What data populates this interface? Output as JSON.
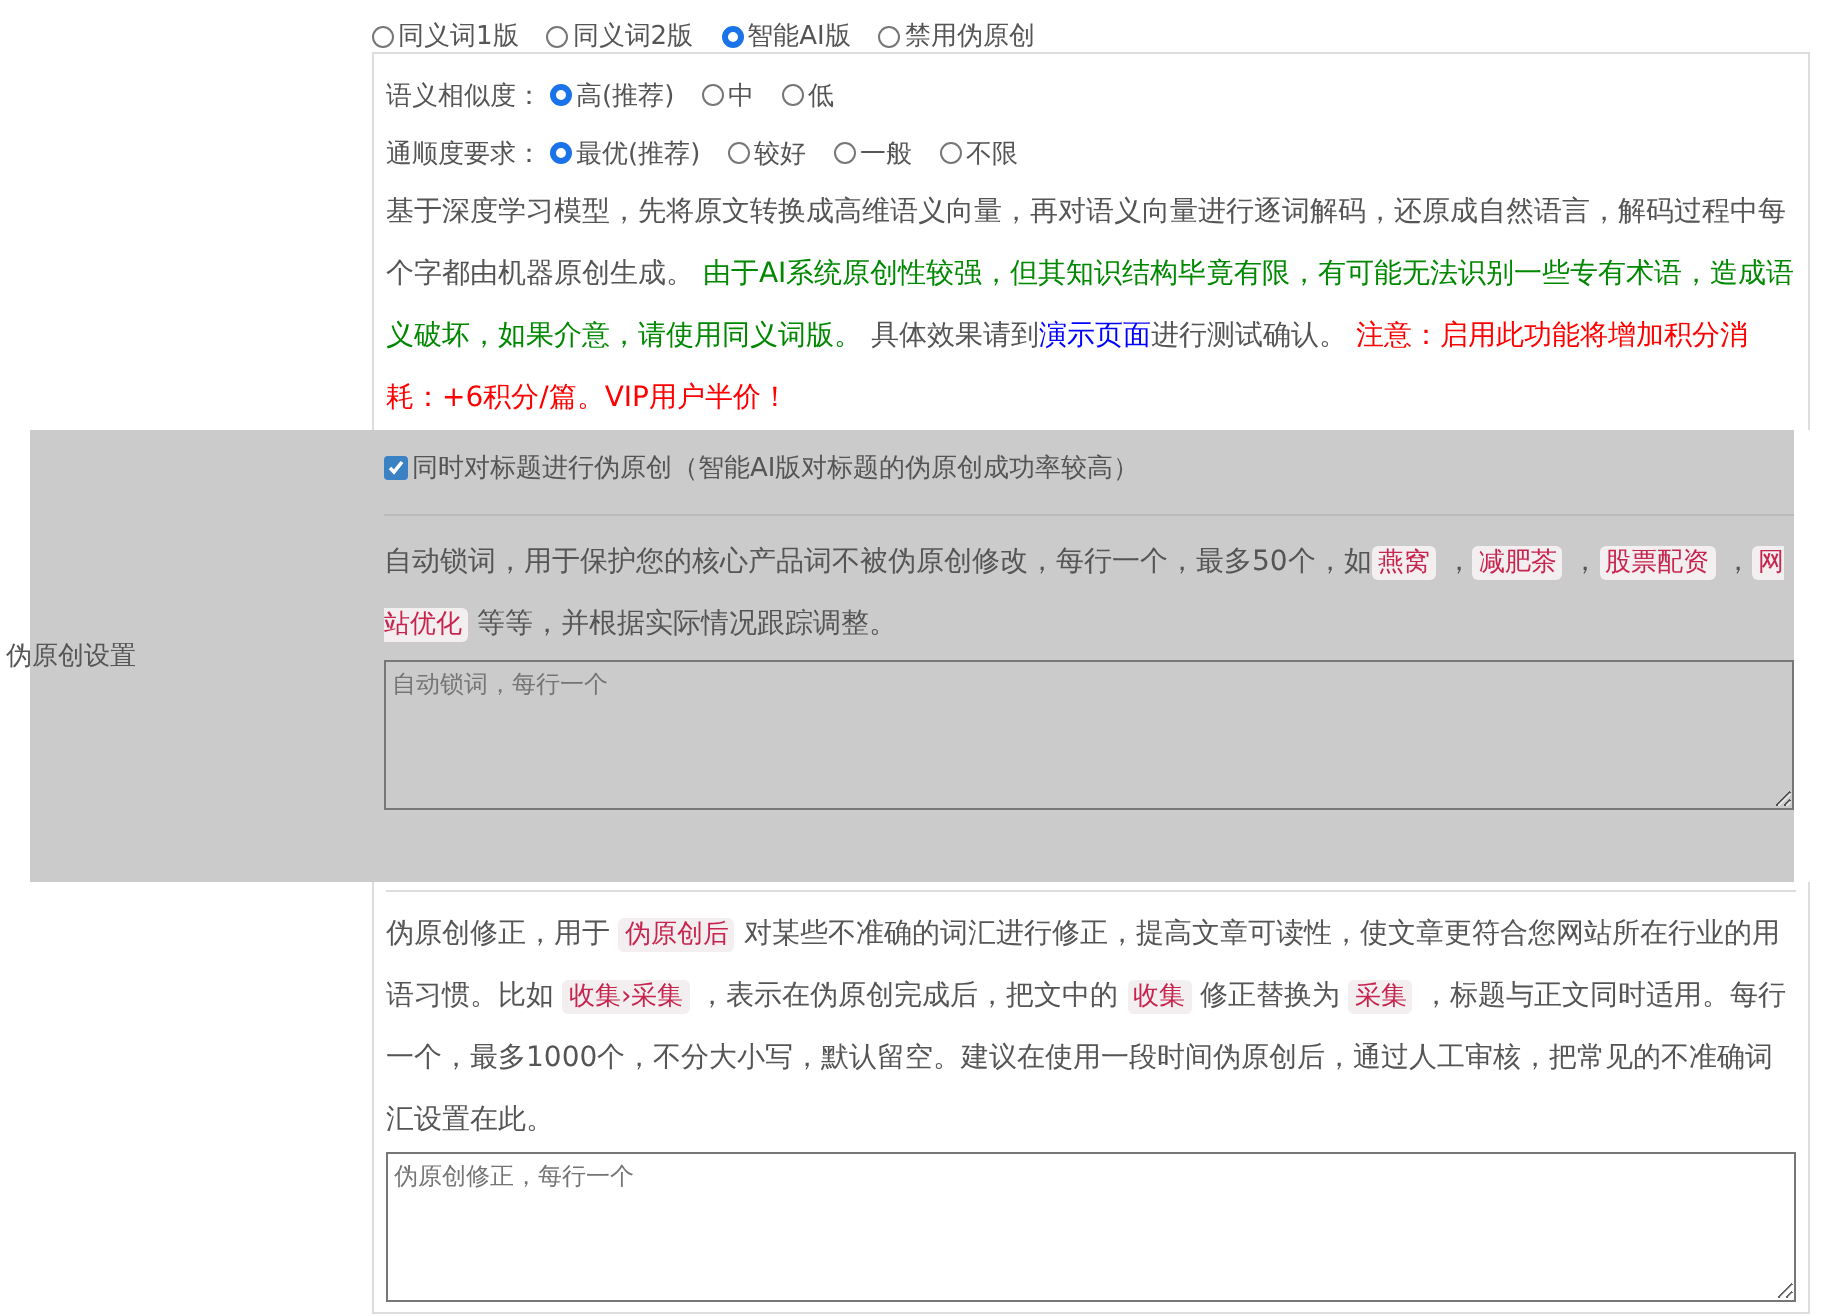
{
  "mode_options": [
    {
      "label": "同义词1版",
      "selected": false
    },
    {
      "label": "同义词2版",
      "selected": false
    },
    {
      "label": "智能AI版",
      "selected": true
    },
    {
      "label": "禁用伪原创",
      "selected": false
    }
  ],
  "settings": [
    {
      "label": "语义相似度：",
      "options": [
        {
          "label": "高(推荐)",
          "selected": true
        },
        {
          "label": "中",
          "selected": false
        },
        {
          "label": "低",
          "selected": false
        }
      ]
    },
    {
      "label": "通顺度要求：",
      "options": [
        {
          "label": "最优(推荐)",
          "selected": true
        },
        {
          "label": "较好",
          "selected": false
        },
        {
          "label": "一般",
          "selected": false
        },
        {
          "label": "不限",
          "selected": false
        }
      ]
    }
  ],
  "ai_description": [
    {
      "kind": "plain",
      "text": "基于深度学习模型，先将原文转换成高维语义向量，再对语义向量进行逐词解码，还原成自然语言，解码过程中每个字都由机器原创生成。 "
    },
    {
      "kind": "good",
      "text": "由于AI系统原创性较强，但其知识结构毕竟有限，有可能无法识别一些专有术语，造成语义破坏，如果介意，请使用同义词版。"
    },
    {
      "kind": "plain",
      "text": " 具体效果请到"
    },
    {
      "kind": "link",
      "text": "演示页面"
    },
    {
      "kind": "plain",
      "text": "进行测试确认。 "
    },
    {
      "kind": "warn",
      "text": "注意：启用此功能将增加积分消耗：+6积分/篇。VIP用户半价！"
    }
  ],
  "section_label": "伪原创设置",
  "title_option": {
    "label": "同时对标题进行伪原创（智能AI版对标题的伪原创成功率较高）",
    "checked": true
  },
  "lock_description": [
    {
      "kind": "plain",
      "text": "自动锁词，用于保护您的核心产品词不被伪原创修改，每行一个，最多50个，如"
    },
    {
      "kind": "tag",
      "text": "燕窝"
    },
    {
      "kind": "plain",
      "text": " ，"
    },
    {
      "kind": "tag",
      "text": "减肥茶"
    },
    {
      "kind": "plain",
      "text": " ，"
    },
    {
      "kind": "tag",
      "text": "股票配资"
    },
    {
      "kind": "plain",
      "text": " ，"
    },
    {
      "kind": "tag",
      "text": "网站优化"
    },
    {
      "kind": "plain",
      "text": " 等等，并根据实际情况跟踪调整。"
    }
  ],
  "lock_field": {
    "placeholder": "自动锁词，每行一个"
  },
  "fix_description": [
    {
      "kind": "plain",
      "text": "伪原创修正，用于 "
    },
    {
      "kind": "tag",
      "text": "伪原创后"
    },
    {
      "kind": "plain",
      "text": " 对某些不准确的词汇进行修正，提高文章可读性，使文章更符合您网站所在行业的用语习惯。比如 "
    },
    {
      "kind": "tag",
      "text": "收集›采集"
    },
    {
      "kind": "plain",
      "text": " ，表示在伪原创完成后，把文中的 "
    },
    {
      "kind": "tag",
      "text": "收集"
    },
    {
      "kind": "plain",
      "text": " 修正替换为 "
    },
    {
      "kind": "tag",
      "text": "采集"
    },
    {
      "kind": "plain",
      "text": " ，标题与正文同时适用。每行一个，最多1000个，不分大小写，默认留空。建议在使用一段时间伪原创后，通过人工审核，把常见的不准确词汇设置在此。"
    }
  ],
  "fix_field": {
    "placeholder": "伪原创修正，每行一个"
  }
}
